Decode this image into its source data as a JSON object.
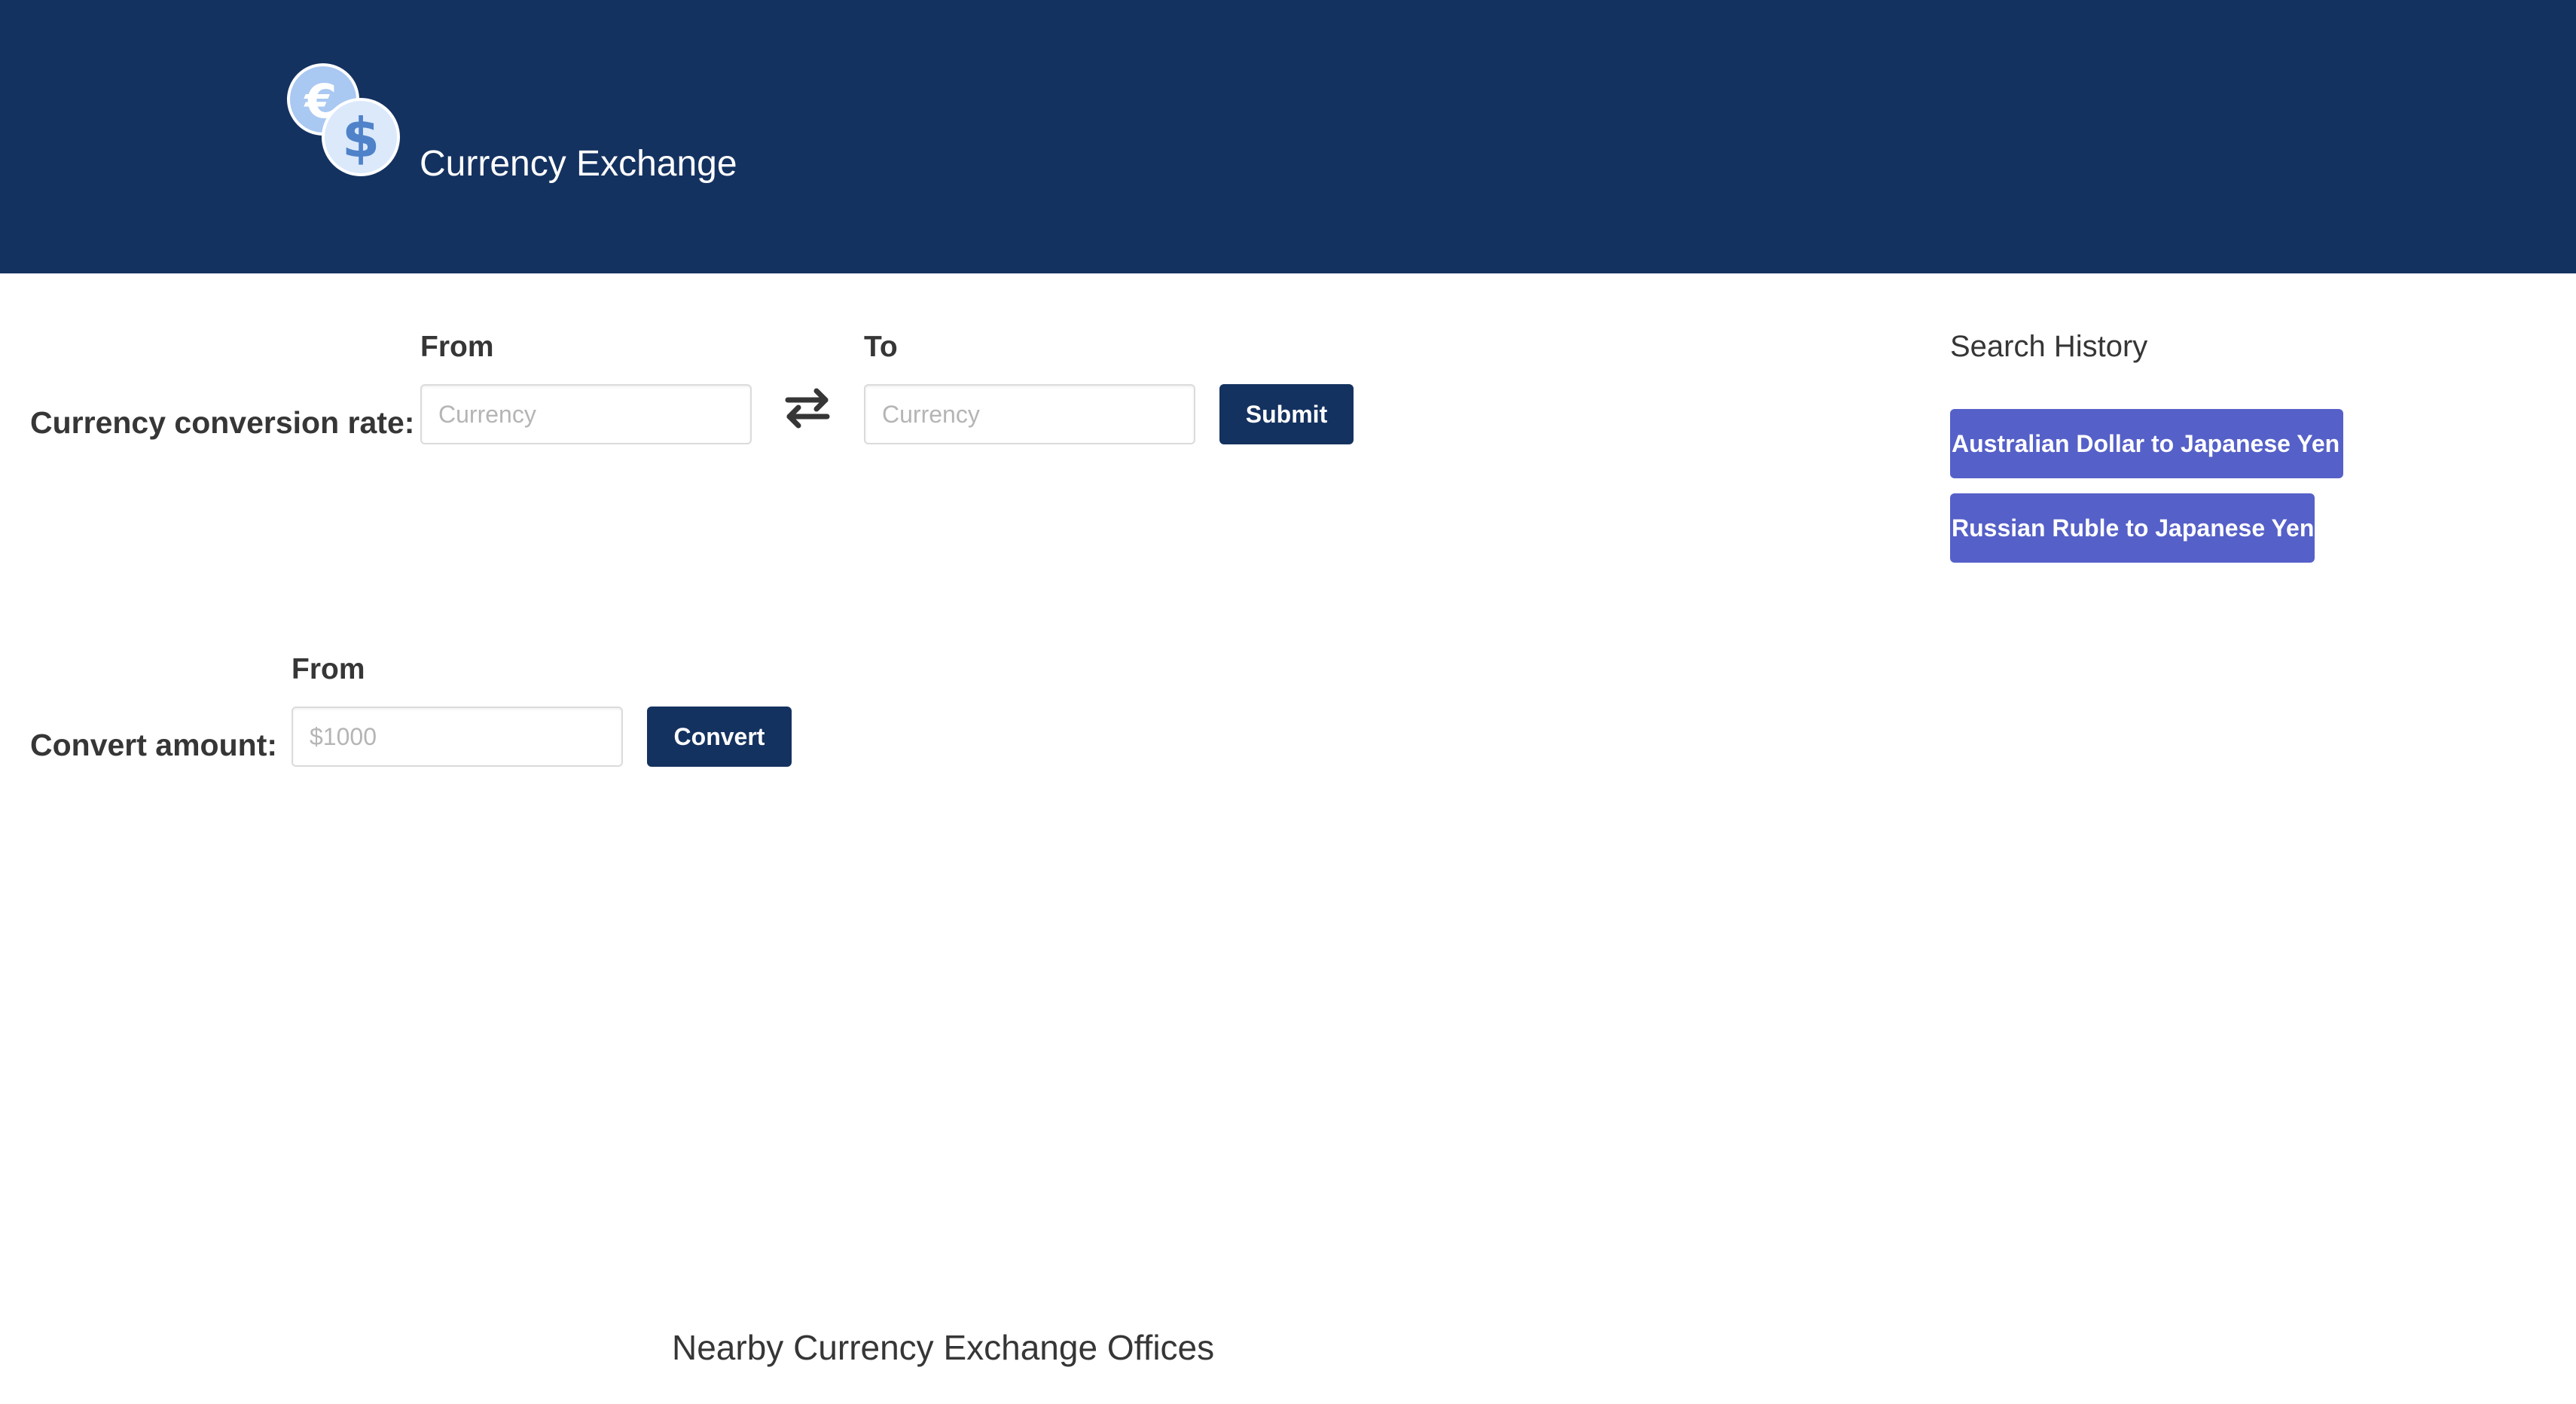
{
  "colors": {
    "header_bg": "#143260",
    "primary_button": "#143260",
    "history_button": "#5560C8",
    "text": "#363636",
    "logo_coin_fill": "#dbe9fb",
    "logo_coin_back": "#a9c8f2",
    "logo_symbol": "#4f82c9"
  },
  "header": {
    "title": "Currency Exchange",
    "logo_icon": "currency-exchange-coins-icon"
  },
  "rate_form": {
    "row_label": "Currency conversion rate:",
    "from_label": "From",
    "from_placeholder": "Currency",
    "from_value": "",
    "to_label": "To",
    "to_placeholder": "Currency",
    "to_value": "",
    "swap_icon": "swap-arrows-icon",
    "submit_label": "Submit"
  },
  "amount_form": {
    "row_label": "Convert amount:",
    "from_label": "From",
    "amount_placeholder": "$1000",
    "amount_value": "",
    "convert_label": "Convert"
  },
  "search_history": {
    "title": "Search History",
    "items": [
      {
        "label": "Australian Dollar to Japanese Yen"
      },
      {
        "label": "Russian Ruble to Japanese Yen"
      }
    ]
  },
  "offices": {
    "title": "Nearby Currency Exchange Offices"
  }
}
